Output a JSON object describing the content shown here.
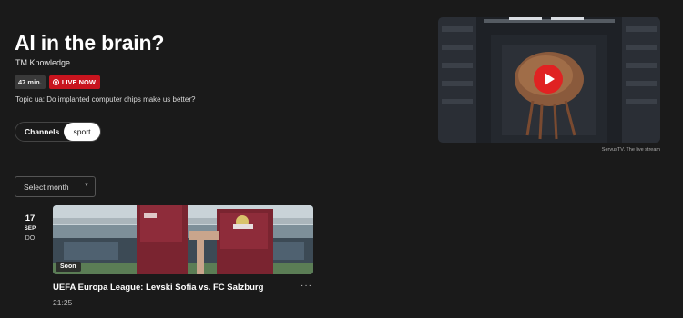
{
  "hero": {
    "title": "AI in the brain?",
    "channel": "TM Knowledge",
    "duration": "47 min.",
    "live_label": "LIVE NOW",
    "topic": "Topic ua: Do implanted computer chips make us better?"
  },
  "filters": {
    "chips": [
      "Channels",
      "sport"
    ],
    "active_chip": "sport"
  },
  "month_select": {
    "label": "Select month"
  },
  "events": [
    {
      "day": "17",
      "month": "SEP",
      "weekday": "DO",
      "tag": "Soon",
      "title": "UEFA Europa League: Levski Sofia vs. FC Salzburg",
      "time": "21:25",
      "more": "···"
    }
  ],
  "video": {
    "caption": "ServusTV. The live stream"
  },
  "colors": {
    "background": "#1a1a1a",
    "live_red": "#c8141e",
    "play_red": "#e02222"
  }
}
